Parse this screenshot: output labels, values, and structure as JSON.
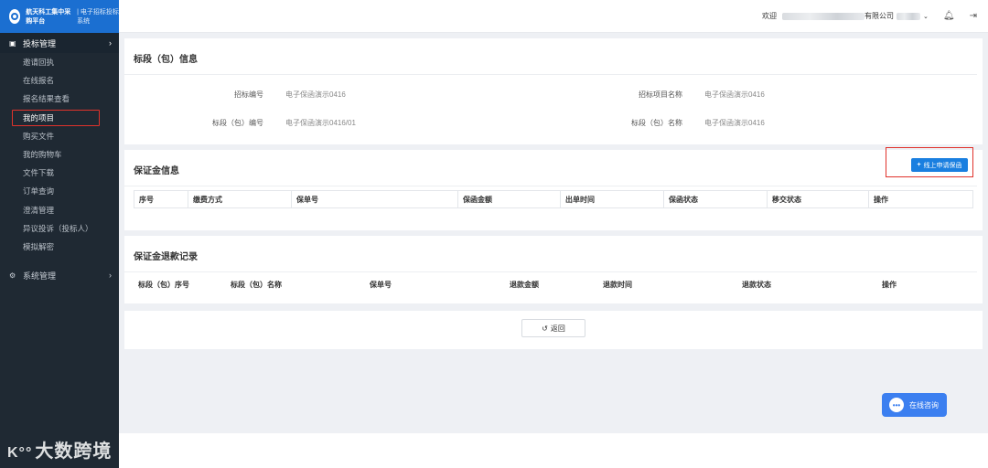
{
  "brand": {
    "name": "航天科工集中采购平台",
    "sub": "| 电子招标投标系统"
  },
  "sidebar": {
    "head": {
      "label": "投标管理",
      "icon": "briefcase-icon"
    },
    "items": [
      {
        "label": "邀请回执"
      },
      {
        "label": "在线报名"
      },
      {
        "label": "报名结果查看"
      },
      {
        "label": "我的项目"
      },
      {
        "label": "购买文件"
      },
      {
        "label": "我的购物车"
      },
      {
        "label": "文件下载"
      },
      {
        "label": "订单查询"
      },
      {
        "label": "澄清管理"
      },
      {
        "label": "异议投诉（投标人）"
      },
      {
        "label": "模拟解密"
      }
    ],
    "system": {
      "label": "系统管理",
      "icon": "gears-icon"
    }
  },
  "header": {
    "welcome": "欢迎",
    "company_suffix": "有限公司"
  },
  "section_info": {
    "title": "标段（包）信息",
    "fields": [
      {
        "label": "招标编号",
        "value": "电子保函演示0416"
      },
      {
        "label": "招标项目名称",
        "value": "电子保函演示0416"
      },
      {
        "label": "标段（包）编号",
        "value": "电子保函演示0416/01"
      },
      {
        "label": "标段（包）名称",
        "value": "电子保函演示0416"
      }
    ]
  },
  "section_deposit": {
    "title": "保证金信息",
    "apply_button": "线上申请保函",
    "columns": [
      "序号",
      "缴费方式",
      "保单号",
      "保函金额",
      "出单时间",
      "保函状态",
      "移交状态",
      "操作"
    ]
  },
  "section_refund": {
    "title": "保证金退款记录",
    "columns": [
      "标段（包）序号",
      "标段（包）名称",
      "保单号",
      "退款金额",
      "退款时间",
      "退款状态",
      "操作"
    ]
  },
  "actions": {
    "back": "返回"
  },
  "chat": {
    "label": "在线咨询"
  },
  "watermark": {
    "text": "大数跨境"
  }
}
